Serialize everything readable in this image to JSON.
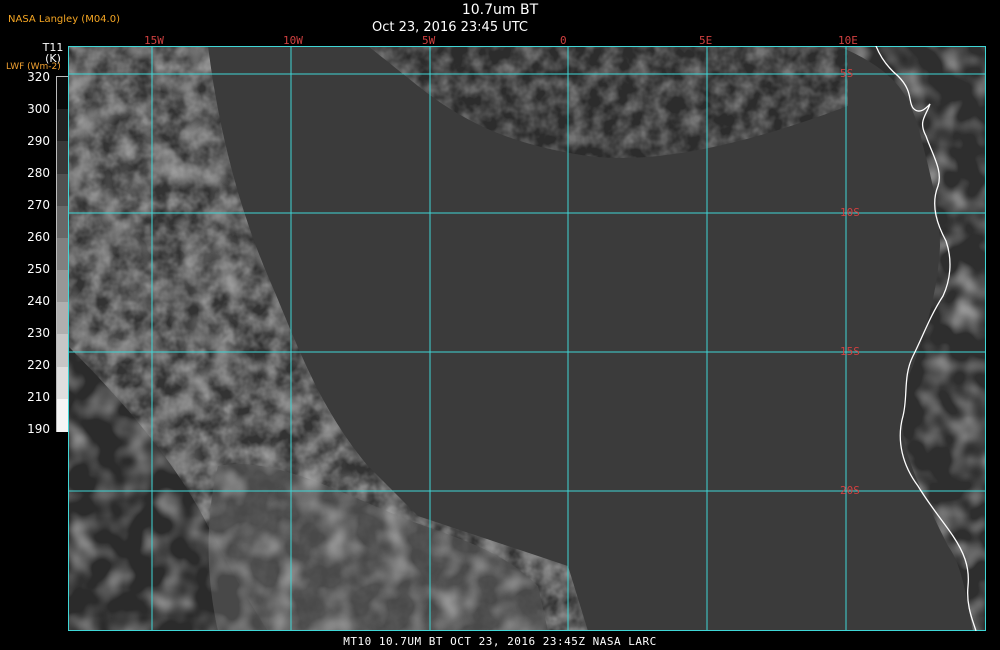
{
  "header": {
    "source": "NASA Langley (M04.0)",
    "title": "10.7um BT",
    "timestamp": "Oct 23, 2016 23:45 UTC"
  },
  "colorscale": {
    "variable": "T11",
    "unit": "(K)",
    "secondary_label": "LWF (Wm-2)",
    "ticks": [
      "320",
      "300",
      "290",
      "280",
      "270",
      "260",
      "250",
      "240",
      "230",
      "220",
      "210",
      "190"
    ]
  },
  "grid": {
    "color": "#3fd6d6",
    "label_color": "#d04040",
    "longitudes": [
      "15W",
      "10W",
      "5W",
      "0",
      "5E",
      "10E"
    ],
    "latitudes": [
      "5S",
      "10S",
      "15S",
      "20S"
    ]
  },
  "map": {
    "coastline_color": "#ffffff",
    "ocean_color": "#3a3a3a"
  },
  "footer": {
    "caption": "MT10  10.7UM BT   OCT 23, 2016 23:45Z   NASA LARC"
  }
}
